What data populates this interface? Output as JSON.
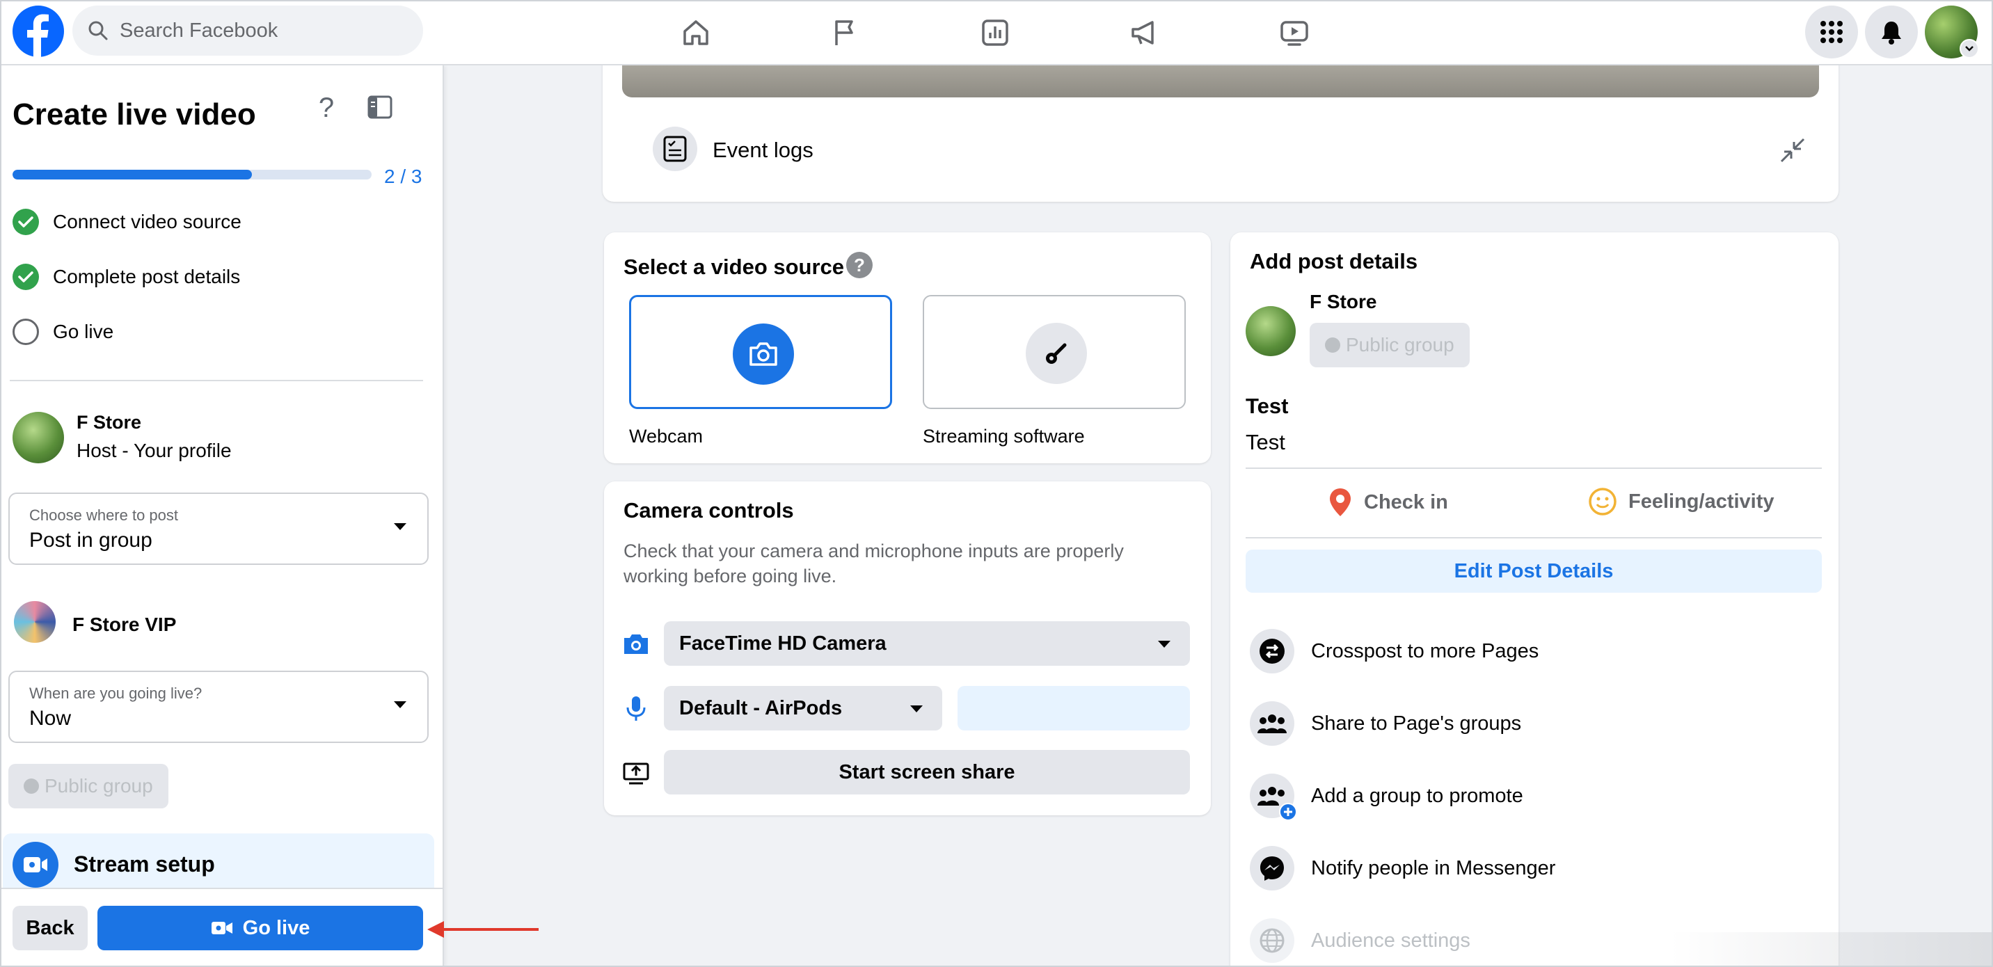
{
  "topbar": {
    "search_placeholder": "Search Facebook",
    "nav": [
      "home-icon",
      "flag-icon",
      "insights-icon",
      "megaphone-icon",
      "video-icon"
    ]
  },
  "sidebar": {
    "title": "Create live video",
    "progress_text": "2 / 3",
    "progress_fraction": 0.667,
    "steps": [
      {
        "label": "Connect video source",
        "done": true
      },
      {
        "label": "Complete post details",
        "done": true
      },
      {
        "label": "Go live",
        "done": false
      }
    ],
    "host": {
      "name": "F Store",
      "role": "Host - Your profile"
    },
    "where": {
      "label": "Choose where to post",
      "value": "Post in group"
    },
    "group_name": "F Store VIP",
    "when": {
      "label": "When are you going live?",
      "value": "Now"
    },
    "privacy": "Public group",
    "stream_setup": "Stream setup",
    "back_label": "Back",
    "golive_label": "Go live"
  },
  "event_logs": {
    "label": "Event logs"
  },
  "video_source": {
    "title": "Select a video source",
    "help": "?",
    "options": [
      {
        "label": "Webcam",
        "selected": true
      },
      {
        "label": "Streaming software",
        "selected": false
      }
    ]
  },
  "camera_controls": {
    "title": "Camera controls",
    "description_line1": "Check that your camera and microphone inputs are properly",
    "description_line2": "working before going live.",
    "camera": "FaceTime HD Camera",
    "microphone": "Default - AirPods",
    "screen_share": "Start screen share"
  },
  "post_details": {
    "title": "Add post details",
    "page_name": "F Store",
    "privacy": "Public group",
    "post_title": "Test",
    "post_text": "Test",
    "check_in": "Check in",
    "feeling": "Feeling/activity",
    "edit": "Edit Post Details",
    "options": [
      {
        "label": "Crosspost to more Pages",
        "icon": "crosspost-icon",
        "disabled": false
      },
      {
        "label": "Share to Page's groups",
        "icon": "groups-icon",
        "disabled": false
      },
      {
        "label": "Add a group to promote",
        "icon": "add-group-icon",
        "disabled": false
      },
      {
        "label": "Notify people in Messenger",
        "icon": "messenger-icon",
        "disabled": false
      },
      {
        "label": "Audience settings",
        "icon": "globe-icon",
        "disabled": true
      }
    ]
  },
  "colors": {
    "accent": "#1b74e4",
    "success": "#31a24c",
    "background": "#f0f2f5"
  }
}
